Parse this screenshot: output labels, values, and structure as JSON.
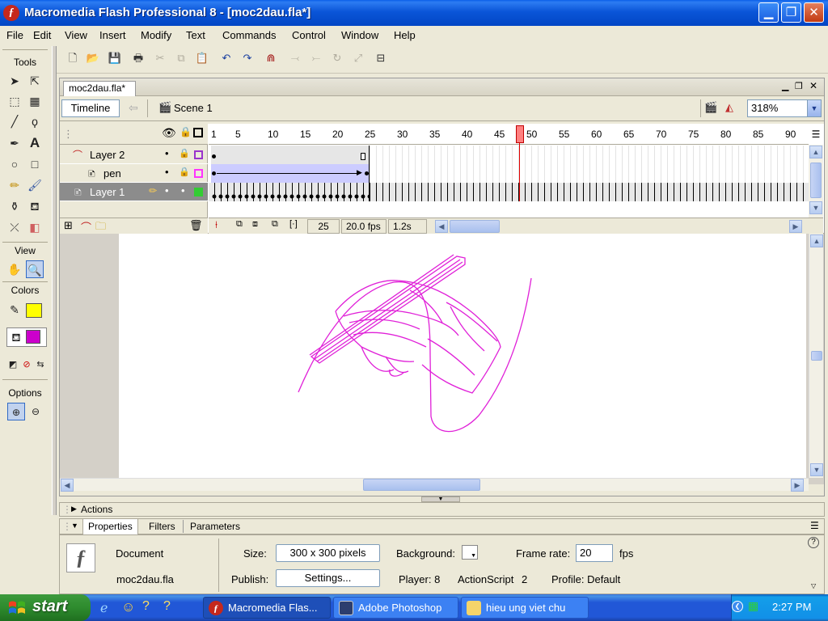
{
  "window": {
    "title": "Macromedia Flash Professional 8 - [moc2dau.fla*]",
    "app_icon": "flash-f-icon",
    "buttons": [
      "minimize-icon",
      "maximize-icon",
      "close-icon"
    ]
  },
  "menu": [
    "File",
    "Edit",
    "View",
    "Insert",
    "Modify",
    "Text",
    "Commands",
    "Control",
    "Window",
    "Help"
  ],
  "tools": {
    "header": "Tools",
    "view_label": "View",
    "colors_label": "Colors",
    "options_label": "Options",
    "stroke_color": "#FFFF00",
    "fill_color": "#CC00CC"
  },
  "document": {
    "tab_label": "moc2dau.fla*",
    "timeline_button": "Timeline",
    "scene_label": "Scene 1",
    "zoom": "318%"
  },
  "timeline": {
    "ruler": [
      "1",
      "5",
      "10",
      "15",
      "20",
      "25",
      "30",
      "35",
      "40",
      "45",
      "50",
      "55",
      "60",
      "65",
      "70",
      "75",
      "80",
      "85",
      "90"
    ],
    "layers": [
      {
        "name": "Layer 2",
        "type": "guide",
        "selected": false
      },
      {
        "name": "pen",
        "type": "guided",
        "selected": false
      },
      {
        "name": "Layer 1",
        "type": "normal",
        "selected": true
      }
    ],
    "current_frame": "25",
    "frame_rate": "20.0 fps",
    "elapsed": "1.2s"
  },
  "stage": {
    "drawing_color": "#E020D8"
  },
  "panels": {
    "actions_label": "Actions",
    "tabs": [
      "Properties",
      "Filters",
      "Parameters"
    ],
    "document_label": "Document",
    "file_name": "moc2dau.fla",
    "size_label": "Size:",
    "size_value": "300 x 300 pixels",
    "publish_label": "Publish:",
    "settings_button": "Settings...",
    "background_label": "Background:",
    "framerate_label": "Frame rate:",
    "framerate_value": "20",
    "fps_label": "fps",
    "player_label": "Player: 8",
    "actionscript_label": "ActionScript",
    "actionscript_value": "2",
    "profile_label": "Profile: Default"
  },
  "taskbar": {
    "start_label": "start",
    "tasks": [
      "Macromedia Flas...",
      "Adobe Photoshop",
      "hieu ung viet chu"
    ],
    "clock": "2:27 PM"
  }
}
